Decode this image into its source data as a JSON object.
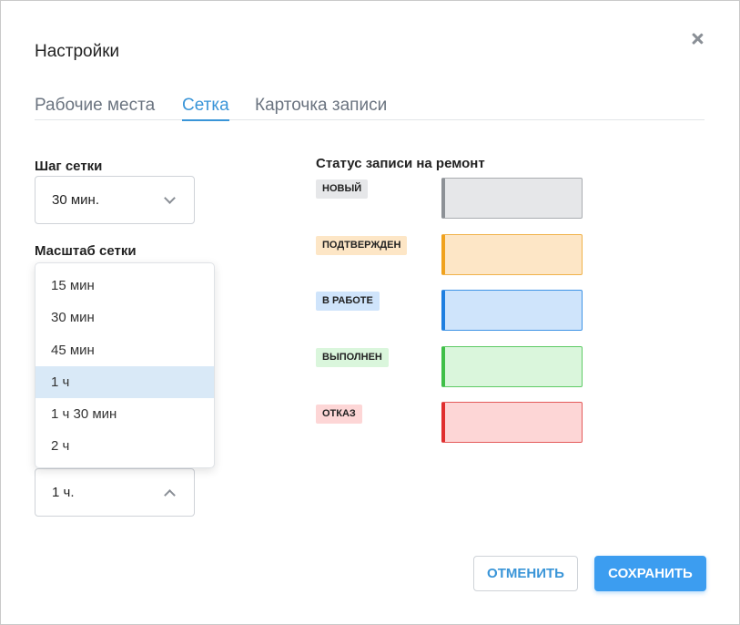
{
  "dialog": {
    "title": "Настройки",
    "close_icon": "close-icon"
  },
  "tabs": [
    {
      "label": "Рабочие места",
      "active": false
    },
    {
      "label": "Сетка",
      "active": true
    },
    {
      "label": "Карточка записи",
      "active": false
    }
  ],
  "grid_step": {
    "label": "Шаг сетки",
    "value": "30 мин."
  },
  "grid_scale": {
    "label": "Масштаб сетки",
    "value": "1 ч.",
    "expanded": true,
    "options": [
      "15 мин",
      "30 мин",
      "45 мин",
      "1 ч",
      "1 ч 30 мин",
      "2 ч"
    ],
    "selected_option": "1 ч"
  },
  "status": {
    "title": "Статус записи на ремонт",
    "items": [
      {
        "label": "НОВЫЙ",
        "badge_bg": "#e6e7e9",
        "fill": "#e6e7e9",
        "border": "#a9acb0",
        "accent": "#8d9196"
      },
      {
        "label": "ПОДТВЕРЖДЕН",
        "badge_bg": "#fde6c6",
        "fill": "#fde6c6",
        "border": "#f0b24a",
        "accent": "#f0a21e"
      },
      {
        "label": "В РАБОТЕ",
        "badge_bg": "#cfe4fb",
        "fill": "#cfe4fb",
        "border": "#3e93e6",
        "accent": "#1f7fe0"
      },
      {
        "label": "ВЫПОЛНЕН",
        "badge_bg": "#daf6dc",
        "fill": "#daf6dc",
        "border": "#5ecb65",
        "accent": "#3fbf48"
      },
      {
        "label": "ОТКАЗ",
        "badge_bg": "#fdd6d6",
        "fill": "#fdd6d6",
        "border": "#e45a5a",
        "accent": "#e02f2f"
      }
    ]
  },
  "actions": {
    "cancel": "ОТМЕНИТЬ",
    "save": "СОХРАНИТЬ"
  },
  "colors": {
    "accent": "#3a95d8",
    "primary_button": "#3c9df0"
  }
}
